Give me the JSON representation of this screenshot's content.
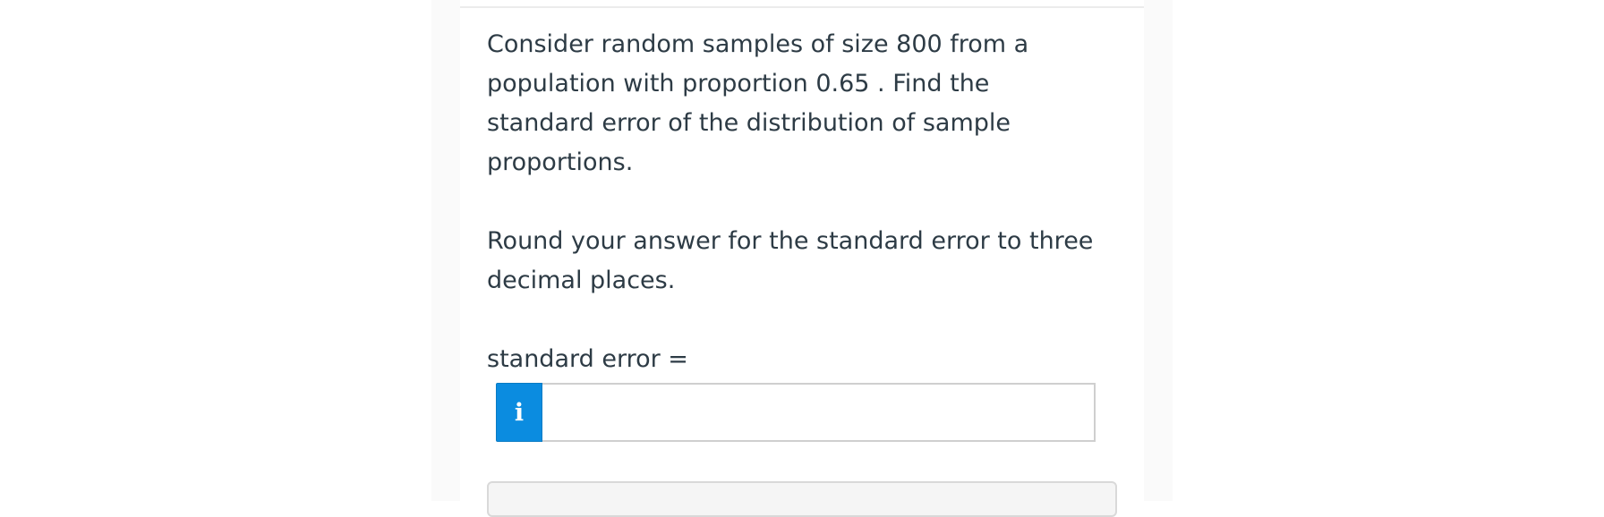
{
  "question": {
    "lines": [
      "Consider random samples of size 800 from a",
      "population with proportion 0.65 . Find the",
      "standard error of the distribution of sample",
      "proportions."
    ],
    "instruction_lines": [
      "Round your answer for the standard error to three",
      "decimal places."
    ]
  },
  "answer": {
    "label": "standard error =",
    "info_icon": "i",
    "icon_name": "info-icon",
    "value": "",
    "placeholder": ""
  },
  "colors": {
    "text": "#2d3b45",
    "info_button": "#0b8ce0"
  }
}
